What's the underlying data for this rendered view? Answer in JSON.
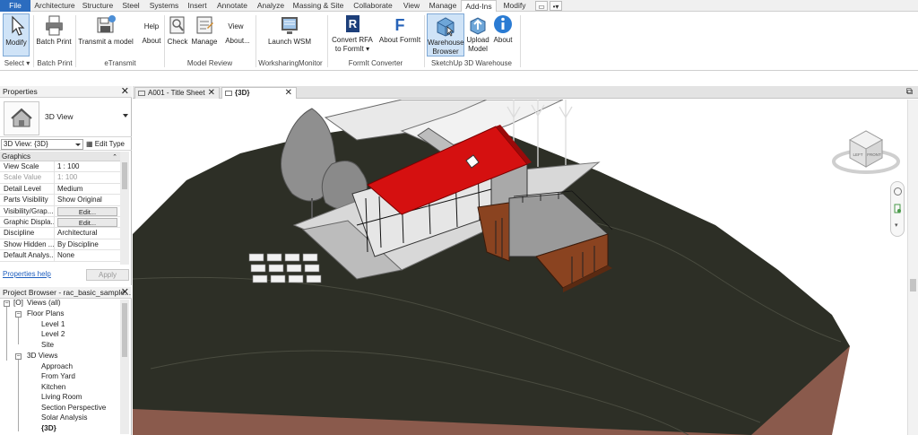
{
  "tabs": [
    "File",
    "Architecture",
    "Structure",
    "Steel",
    "Systems",
    "Insert",
    "Annotate",
    "Analyze",
    "Massing & Site",
    "Collaborate",
    "View",
    "Manage",
    "Add-Ins",
    "Modify"
  ],
  "active_tab": "Add-Ins",
  "ribbon": {
    "modify": "Modify",
    "select": "Select",
    "batch_print": "Batch Print",
    "batch_print_panel": "Batch Print",
    "transmit_model": "Transmit a model",
    "etransmit_panel": "eTransmit",
    "help": "Help",
    "about": "About",
    "check": "Check",
    "manage": "Manage",
    "view": "View",
    "about_ellipsis": "About...",
    "model_review_panel": "Model Review",
    "launch_wsm": "Launch WSM",
    "wsm_panel": "WorksharingMonitor",
    "convert_rfa_1": "Convert RFA",
    "convert_rfa_2": "to FormIt",
    "about_formit": "About FormIt",
    "formit_panel": "FormIt Converter",
    "warehouse_1": "Warehouse",
    "warehouse_2": "Browser",
    "upload_1": "Upload",
    "upload_2": "Model",
    "about_sketchup": "About",
    "sketchup_panel": "SketchUp 3D Warehouse"
  },
  "properties": {
    "title": "Properties",
    "type_name": "3D View",
    "instance": "3D View: {3D}",
    "edit_type": "Edit Type",
    "group": "Graphics",
    "rows": [
      {
        "k": "View Scale",
        "v": "1 : 100"
      },
      {
        "k": "Scale Value",
        "v": "1: 100"
      },
      {
        "k": "Detail Level",
        "v": "Medium"
      },
      {
        "k": "Parts Visibility",
        "v": "Show Original"
      },
      {
        "k": "Visibility/Grap...",
        "v": "Edit..."
      },
      {
        "k": "Graphic Displa...",
        "v": "Edit..."
      },
      {
        "k": "Discipline",
        "v": "Architectural"
      },
      {
        "k": "Show Hidden ...",
        "v": "By Discipline"
      },
      {
        "k": "Default Analys...",
        "v": "None"
      }
    ],
    "help_link": "Properties help",
    "apply": "Apply"
  },
  "browser": {
    "title": "Project Browser - rac_basic_sample...",
    "views_all": "Views (all)",
    "floor_plans": "Floor Plans",
    "floor_items": [
      "Level 1",
      "Level 2",
      "Site"
    ],
    "views_3d": "3D Views",
    "views_3d_items": [
      "Approach",
      "From Yard",
      "Kitchen",
      "Living Room",
      "Section Perspective",
      "Solar Analysis",
      "{3D}"
    ]
  },
  "view_tabs": [
    "A001 - Title Sheet",
    "{3D}"
  ],
  "viewcube": {
    "left": "LEFT",
    "front": "FRONT"
  },
  "colors": {
    "file_tab": "#2b6cbf",
    "roof": "#d51010",
    "ground": "#2d2f26",
    "soil": "#8a5a4c",
    "cladding": "#8a4320"
  }
}
